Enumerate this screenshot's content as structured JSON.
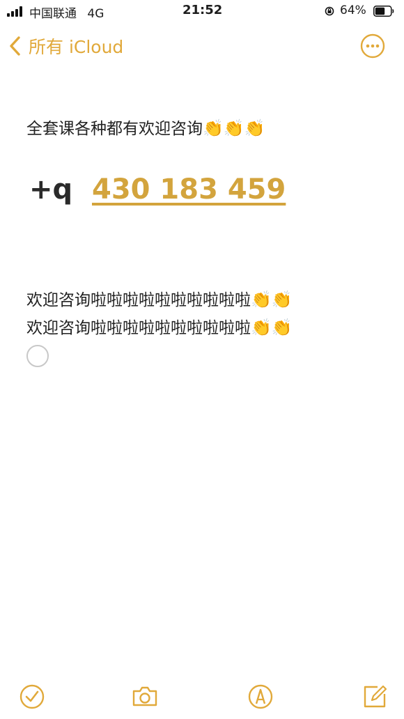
{
  "status_bar": {
    "carrier": "中国联通",
    "network": "4G",
    "time": "21:52",
    "battery_percent": "64%",
    "battery_level": 0.64
  },
  "nav": {
    "back_label": "所有 iCloud",
    "accent_color": "#E1A93A"
  },
  "note": {
    "line1_text": "全套课各种都有欢迎咨询",
    "line1_emoji": "👏👏👏",
    "contact_prefix": "+q",
    "contact_number": "430 183 459",
    "line3_text": "欢迎咨询啦啦啦啦啦啦啦啦啦啦",
    "line3_emoji": "👏👏",
    "line4_text": "欢迎咨询啦啦啦啦啦啦啦啦啦啦",
    "line4_emoji": "👏👏"
  },
  "toolbar": {
    "icons": [
      "checklist-icon",
      "camera-icon",
      "markup-icon",
      "compose-icon"
    ]
  }
}
